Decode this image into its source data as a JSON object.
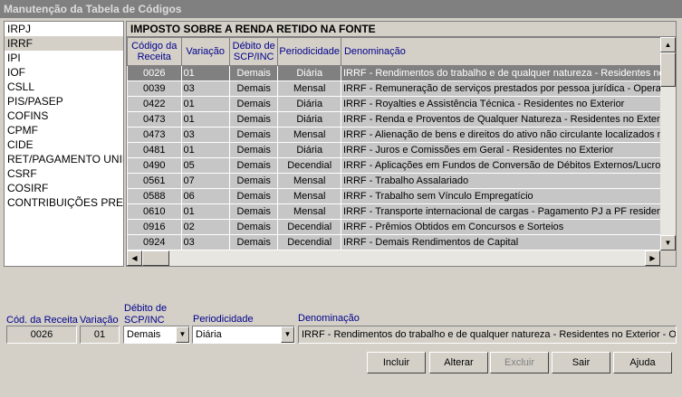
{
  "window": {
    "title": "Manutenção da Tabela de Códigos"
  },
  "categories": {
    "selected_index": 1,
    "items": [
      "IRPJ",
      "IRRF",
      "IPI",
      "IOF",
      "CSLL",
      "PIS/PASEP",
      "COFINS",
      "CPMF",
      "CIDE",
      "RET/PAGAMENTO UNIFI",
      "CSRF",
      "COSIRF",
      "CONTRIBUIÇÕES PREVID"
    ]
  },
  "grid": {
    "title": "IMPOSTO SOBRE A RENDA RETIDO NA FONTE",
    "headers": {
      "codigo": "Código da Receita",
      "variacao": "Variação",
      "debito": "Débito de SCP/INC",
      "periodicidade": "Periodicidade",
      "denominacao": "Denominação"
    },
    "selected_index": 0,
    "rows": [
      {
        "codigo": "0026",
        "variacao": "01",
        "debito": "Demais",
        "periodicidade": "Diária",
        "denominacao": "IRRF - Rendimentos do trabalho e de qualquer natureza - Residentes no Exterior"
      },
      {
        "codigo": "0039",
        "variacao": "03",
        "debito": "Demais",
        "periodicidade": "Mensal",
        "denominacao": "IRRF - Remuneração de serviços prestados por pessoa jurídica - Operações"
      },
      {
        "codigo": "0422",
        "variacao": "01",
        "debito": "Demais",
        "periodicidade": "Diária",
        "denominacao": "IRRF - Royalties e Assistência Técnica - Residentes no Exterior"
      },
      {
        "codigo": "0473",
        "variacao": "01",
        "debito": "Demais",
        "periodicidade": "Diária",
        "denominacao": "IRRF - Renda e Proventos de Qualquer Natureza - Residentes no Exterior"
      },
      {
        "codigo": "0473",
        "variacao": "03",
        "debito": "Demais",
        "periodicidade": "Mensal",
        "denominacao": "IRRF - Alienação de bens e direitos do ativo não circulante localizados no Brasil"
      },
      {
        "codigo": "0481",
        "variacao": "01",
        "debito": "Demais",
        "periodicidade": "Diária",
        "denominacao": "IRRF - Juros e Comissões em Geral - Residentes no Exterior"
      },
      {
        "codigo": "0490",
        "variacao": "05",
        "debito": "Demais",
        "periodicidade": "Decendial",
        "denominacao": "IRRF - Aplicações em Fundos de Conversão de Débitos Externos/Lucros"
      },
      {
        "codigo": "0561",
        "variacao": "07",
        "debito": "Demais",
        "periodicidade": "Mensal",
        "denominacao": "IRRF - Trabalho Assalariado"
      },
      {
        "codigo": "0588",
        "variacao": "06",
        "debito": "Demais",
        "periodicidade": "Mensal",
        "denominacao": "IRRF - Trabalho sem Vínculo Empregatício"
      },
      {
        "codigo": "0610",
        "variacao": "01",
        "debito": "Demais",
        "periodicidade": "Mensal",
        "denominacao": "IRRF - Transporte internacional de cargas - Pagamento PJ a PF residente"
      },
      {
        "codigo": "0916",
        "variacao": "02",
        "debito": "Demais",
        "periodicidade": "Decendial",
        "denominacao": "IRRF - Prêmios Obtidos em Concursos e Sorteios"
      },
      {
        "codigo": "0924",
        "variacao": "03",
        "debito": "Demais",
        "periodicidade": "Decendial",
        "denominacao": "IRRF - Demais Rendimentos de Capital"
      }
    ]
  },
  "form": {
    "codigo_label": "Cód. da Receita",
    "codigo_value": "0026",
    "variacao_label": "Variação",
    "variacao_value": "01",
    "debito_label_1": "Débito de",
    "debito_label_2": "SCP/INC",
    "debito_value": "Demais",
    "periodicidade_label": "Periodicidade",
    "periodicidade_value": "Diária",
    "denominacao_label": "Denominação",
    "denominacao_value": "IRRF - Rendimentos do trabalho e de qualquer natureza - Residentes no Exterior - Op"
  },
  "buttons": {
    "incluir": "Incluir",
    "alterar": "Alterar",
    "excluir": "Excluir",
    "sair": "Sair",
    "ajuda": "Ajuda"
  },
  "icons": {
    "scroll_up": "arrow-up-icon",
    "scroll_down": "arrow-down-icon",
    "scroll_left": "arrow-left-icon",
    "scroll_right": "arrow-right-icon",
    "dropdown": "chevron-down-icon"
  }
}
